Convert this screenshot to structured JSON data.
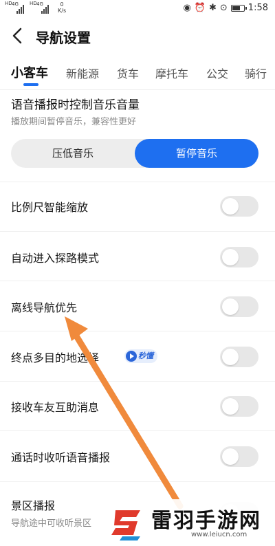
{
  "status_bar": {
    "speed_value": "0",
    "speed_unit": "K/s",
    "net_badges": [
      "4G",
      "4G"
    ],
    "hd_badges": [
      "HD",
      "HD"
    ],
    "battery_icon": "battery-icon",
    "time": "1:58"
  },
  "header": {
    "back_icon": "chevron-left-icon",
    "title": "导航设置"
  },
  "tabs": [
    {
      "label": "小客车",
      "active": true
    },
    {
      "label": "新能源",
      "active": false
    },
    {
      "label": "货车",
      "active": false
    },
    {
      "label": "摩托车",
      "active": false
    },
    {
      "label": "公交",
      "active": false
    },
    {
      "label": "骑行",
      "active": false
    }
  ],
  "music_control": {
    "title": "语音播报时控制音乐音量",
    "subtitle": "播放期间暂停音乐，兼容性更好",
    "options": [
      "压低音乐",
      "暂停音乐"
    ],
    "selected": "暂停音乐",
    "accent_color": "#1e6ff0"
  },
  "settings": [
    {
      "label": "比例尺智能缩放",
      "enabled": false
    },
    {
      "label": "自动进入探路模式",
      "enabled": false
    },
    {
      "label": "离线导航优先",
      "enabled": false
    },
    {
      "label": "终点多目的地选择",
      "enabled": false,
      "badge": "秒懂"
    },
    {
      "label": "接收车友互助消息",
      "enabled": false
    },
    {
      "label": "通话时收听语音播报",
      "enabled": false
    },
    {
      "label": "景区播报",
      "sub": "导航途中可收听景区",
      "enabled": false
    }
  ],
  "annotation": {
    "arrow_color": "#f08a3c"
  },
  "watermark": {
    "title": "雷羽手游网",
    "url": "www.leiucn.com"
  }
}
